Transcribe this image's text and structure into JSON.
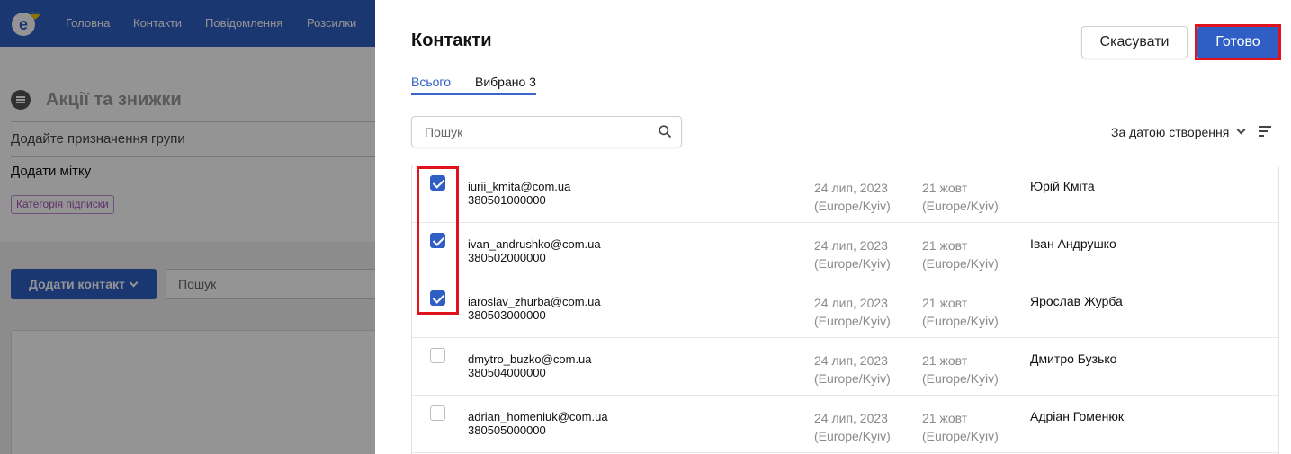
{
  "nav": {
    "items": [
      "Головна",
      "Контакти",
      "Повідомлення",
      "Розсилки"
    ]
  },
  "background": {
    "group_title": "Акції та знижки",
    "group_purpose": "Додайте призначення групи",
    "add_tag": "Додати мітку",
    "tag_label": "Категорія підписки",
    "add_contact_label": "Додати контакт",
    "search_text": "Пошук"
  },
  "drawer": {
    "title": "Контакти",
    "cancel_label": "Скасувати",
    "done_label": "Готово",
    "tabs": {
      "all": "Всього",
      "selected": "Вибрано 3"
    },
    "search_placeholder": "Пошук",
    "sort_label": "За датою створення",
    "contacts": [
      {
        "email": "iurii_kmita@com.ua",
        "phone": "380501000000",
        "created": "24 лип, 2023",
        "created_tz": "(Europe/Kyiv)",
        "updated": "21 жовт",
        "updated_tz": "(Europe/Kyiv)",
        "name": "Юрій Кміта",
        "checked": true
      },
      {
        "email": "ivan_andrushko@com.ua",
        "phone": "380502000000",
        "created": "24 лип, 2023",
        "created_tz": "(Europe/Kyiv)",
        "updated": "21 жовт",
        "updated_tz": "(Europe/Kyiv)",
        "name": "Іван Андрушко",
        "checked": true
      },
      {
        "email": "iaroslav_zhurba@com.ua",
        "phone": "380503000000",
        "created": "24 лип, 2023",
        "created_tz": "(Europe/Kyiv)",
        "updated": "21 жовт",
        "updated_tz": "(Europe/Kyiv)",
        "name": "Ярослав Журба",
        "checked": true
      },
      {
        "email": "dmytro_buzko@com.ua",
        "phone": "380504000000",
        "created": "24 лип, 2023",
        "created_tz": "(Europe/Kyiv)",
        "updated": "21 жовт",
        "updated_tz": "(Europe/Kyiv)",
        "name": "Дмитро Бузько",
        "checked": false
      },
      {
        "email": "adrian_homeniuk@com.ua",
        "phone": "380505000000",
        "created": "24 лип, 2023",
        "created_tz": "(Europe/Kyiv)",
        "updated": "21 жовт",
        "updated_tz": "(Europe/Kyiv)",
        "name": "Адріан Гоменюк",
        "checked": false
      }
    ]
  },
  "icons": {
    "logo": "esputnik-logo-icon",
    "search": "search-icon",
    "sort": "sort-lines-icon",
    "group": "list-icon"
  },
  "colors": {
    "primary": "#2f5fc4",
    "highlight": "#e0131c",
    "tag": "#a054b8",
    "muted": "#8a8a8a"
  }
}
